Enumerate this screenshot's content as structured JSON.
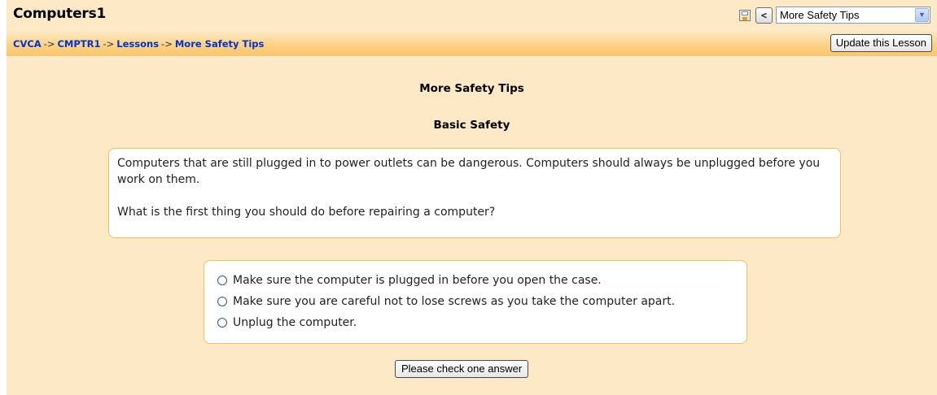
{
  "header": {
    "site_title": "Computers1",
    "prev_button": "<",
    "page_select": {
      "selected": "More Safety Tips"
    }
  },
  "navbar": {
    "breadcrumb": [
      "CVCA",
      "CMPTR1",
      "Lessons",
      "More Safety Tips"
    ],
    "separator": "->",
    "update_button": "Update this Lesson"
  },
  "lesson": {
    "title": "More Safety Tips",
    "section_title": "Basic Safety",
    "paragraphs": [
      "Computers that are still plugged in to power outlets can be dangerous. Computers should always be unplugged before you work on them.",
      "What is the first thing you should do before repairing a computer?"
    ],
    "answers": [
      "Make sure the computer is plugged in before you open the case.",
      "Make sure you are careful not to lose screws as you take the computer apart.",
      "Unplug the computer."
    ],
    "submit_button": "Please check one answer"
  },
  "icons": {
    "save": "save-icon",
    "prev": "previous-page-button",
    "dropdown": "chevron-down-icon",
    "radio": "radio-button"
  },
  "colors": {
    "page_background": "#fde9c5",
    "navbar": "#fbc66a",
    "link": "#0033cc",
    "box_border": "#f0c060"
  }
}
